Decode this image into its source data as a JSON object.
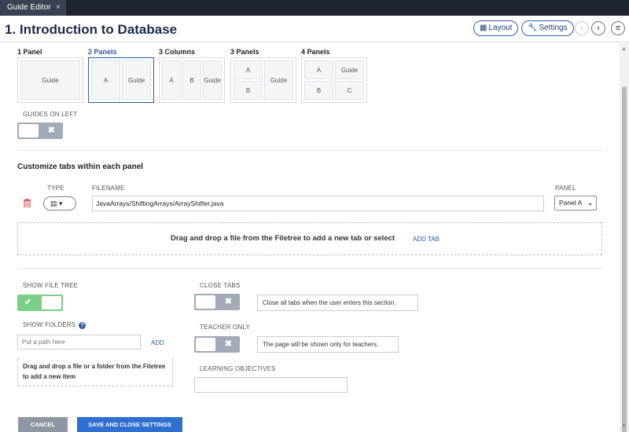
{
  "tab": {
    "label": "Guide Editor",
    "close": "×"
  },
  "header": {
    "title": "1. Introduction to Database",
    "layout_label": "Layout",
    "settings_label": "Settings",
    "prev": "‹",
    "next": "›",
    "menu": "≡"
  },
  "layouts": [
    {
      "label": "1 Panel",
      "cells": [
        "Guide"
      ]
    },
    {
      "label": "2 Panels",
      "cells": [
        "A",
        "Guide"
      ],
      "selected": true
    },
    {
      "label": "3 Columns",
      "cells": [
        "A",
        "B",
        "Guide"
      ]
    },
    {
      "label": "3 Panels",
      "cells": [
        "A",
        "B",
        "Guide"
      ]
    },
    {
      "label": "4 Panels",
      "cells": [
        "A",
        "Guide",
        "B",
        "C"
      ]
    }
  ],
  "guides_on_left": {
    "label": "GUIDES ON LEFT",
    "on": false
  },
  "tabs_section": {
    "title": "Customize tabs within each panel",
    "type_header": "TYPE",
    "filename_header": "FILENAME",
    "panel_header": "PANEL",
    "row": {
      "type_icon": "file-icon",
      "filename": "JavaArrays/ShiftingArrays/ArrayShifter.java",
      "panel": "Panel A"
    },
    "drop_text": "Drag and drop a file from the Filetree to add a new tab or select",
    "add_tab": "ADD TAB"
  },
  "show_file_tree": {
    "label": "SHOW FILE TREE",
    "on": true
  },
  "show_folders": {
    "label": "SHOW FOLDERS",
    "help": "?",
    "placeholder": "Put a path here",
    "add": "ADD",
    "drop_text": "Drag and drop a file or a folder from the Filetree to add a new item"
  },
  "close_tabs": {
    "label": "CLOSE TABS",
    "on": false,
    "description": "Close all tabs when the user enters this section."
  },
  "teacher_only": {
    "label": "TEACHER ONLY",
    "on": false,
    "description": "The page will be shown only for teachers."
  },
  "learning_objectives": {
    "label": "LEARNING OBJECTIVES",
    "value": ""
  },
  "footer": {
    "cancel": "CANCEL",
    "save": "SAVE AND CLOSE SETTINGS"
  },
  "colors": {
    "accent": "#2e5aa8",
    "toggle_on": "#7ccf86",
    "toggle_off": "#a2aab8",
    "delete": "#d9534f"
  }
}
